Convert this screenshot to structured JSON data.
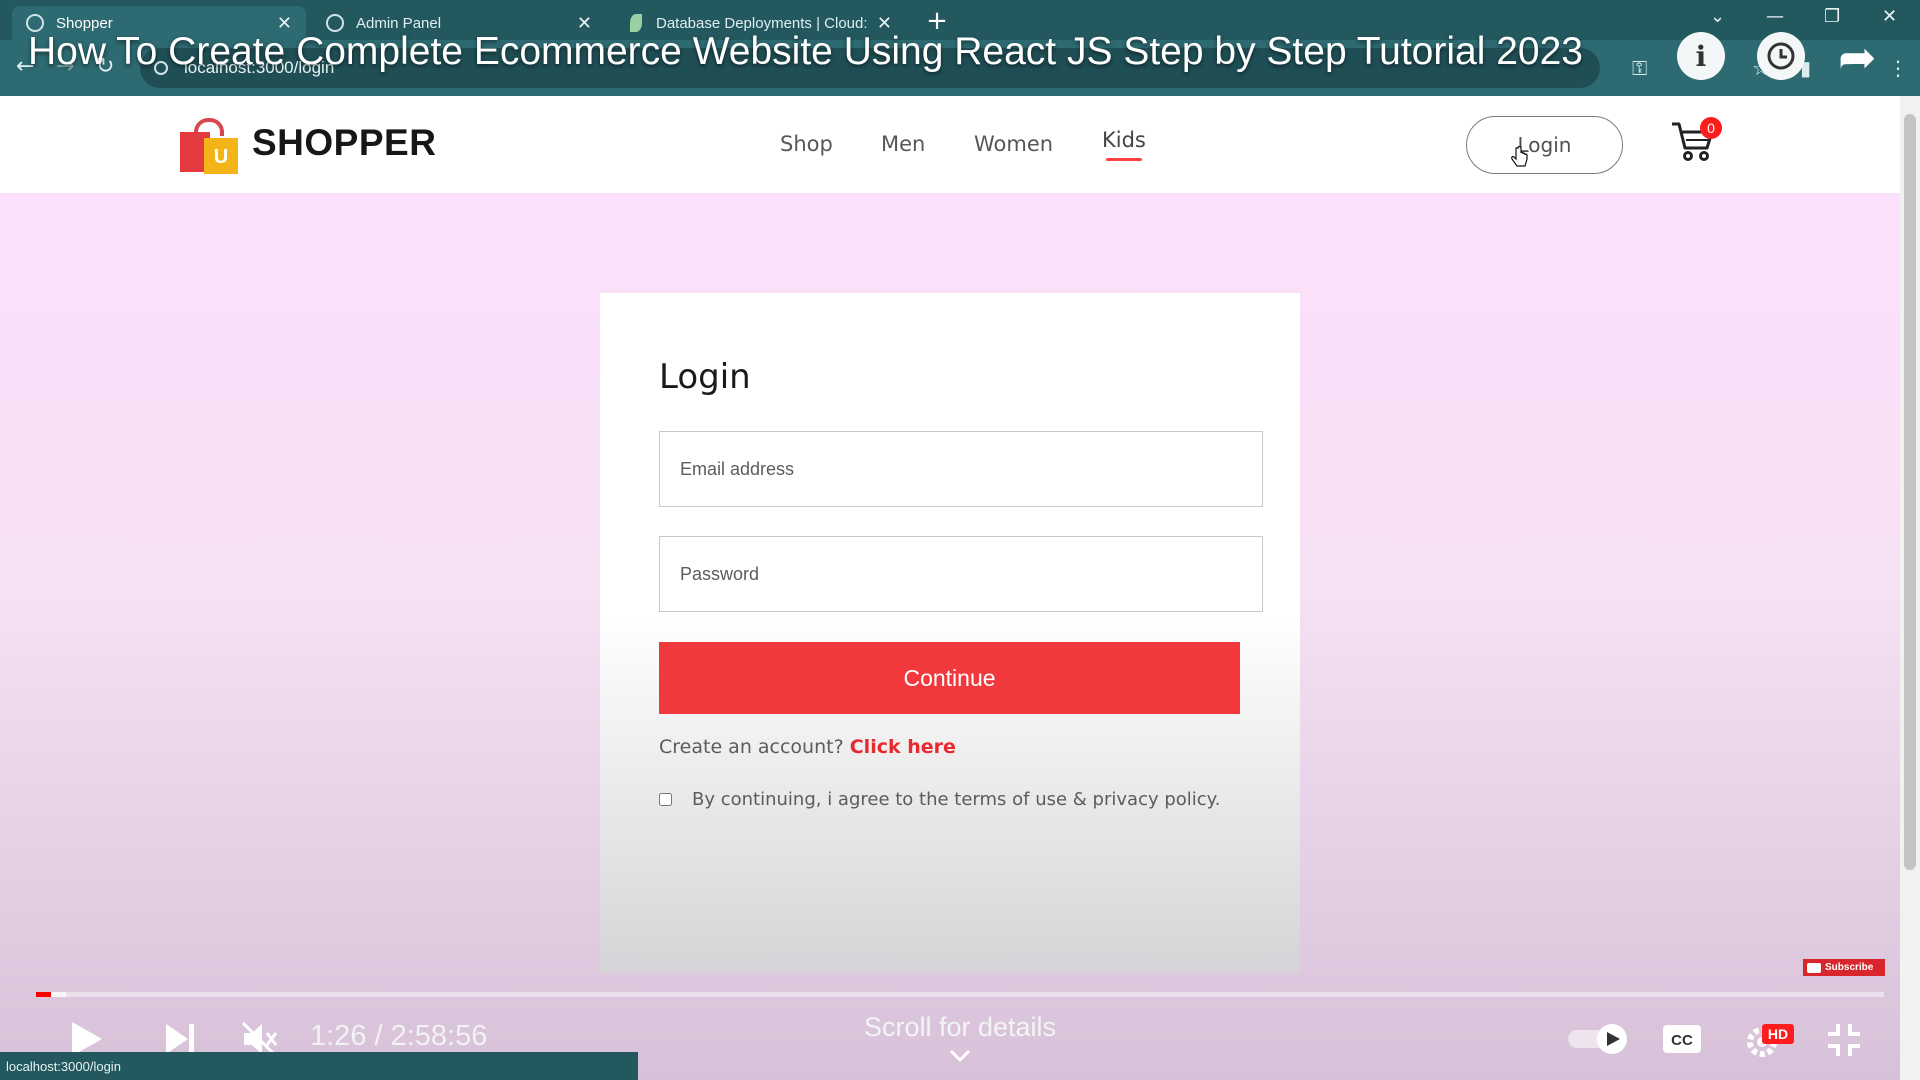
{
  "browser": {
    "tabs": [
      {
        "title": "Shopper",
        "active": true
      },
      {
        "title": "Admin Panel",
        "active": false
      },
      {
        "title": "Database Deployments | Cloud: ",
        "active": false
      }
    ],
    "url": "localhost:3000/login",
    "status_url": "localhost:3000/login"
  },
  "video": {
    "title": "How To Create Complete Ecommerce Website Using React JS Step by Step Tutorial 2023",
    "current_time": "1:26",
    "duration": "2:58:56",
    "time_display": "1:26 / 2:58:56",
    "played_fraction": 0.008,
    "buffered_fraction": 0.016,
    "scroll_hint": "Scroll for details",
    "subscribe_label": "Subscribe",
    "hd_label": "HD"
  },
  "site": {
    "logo_text": "SHOPPER",
    "logo_letter": "U",
    "menu": [
      "Shop",
      "Men",
      "Women",
      "Kids"
    ],
    "active_menu": "Kids",
    "login_label": "Login",
    "cart_count": "0"
  },
  "login_form": {
    "heading": "Login",
    "email_placeholder": "Email address",
    "password_placeholder": "Password",
    "continue_label": "Continue",
    "signup_prompt": "Create an account?",
    "signup_link": "Click here",
    "agree_text": "By continuing, i agree to the terms of use & privacy policy."
  },
  "colors": {
    "accent_red": "#f0383d",
    "page_pink": "#fbe0fb",
    "chrome_teal": "#2d6a71"
  }
}
